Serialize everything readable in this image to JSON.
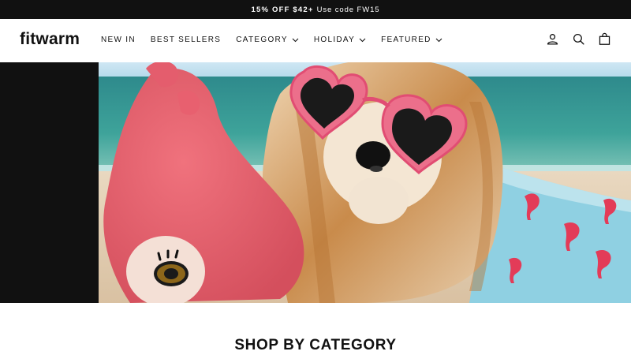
{
  "announcement": {
    "highlight": "15% OFF $42+",
    "text": "Use code FW15"
  },
  "brand": {
    "logo": "fitwarm"
  },
  "nav": {
    "items": [
      {
        "label": "NEW IN",
        "has_dropdown": false
      },
      {
        "label": "BEST SELLERS",
        "has_dropdown": false
      },
      {
        "label": "CATEGORY",
        "has_dropdown": true
      },
      {
        "label": "HOLIDAY",
        "has_dropdown": true
      },
      {
        "label": "FEATURED",
        "has_dropdown": true
      }
    ]
  },
  "header_icons": [
    "account-icon",
    "search-icon",
    "cart-bag-icon"
  ],
  "hero": {
    "image": "dog-with-heart-sunglasses-on-beach"
  },
  "sections": {
    "shop_by_category": "SHOP BY CATEGORY"
  },
  "colors": {
    "announcement_bg": "#111111",
    "text": "#111111",
    "background": "#ffffff"
  }
}
